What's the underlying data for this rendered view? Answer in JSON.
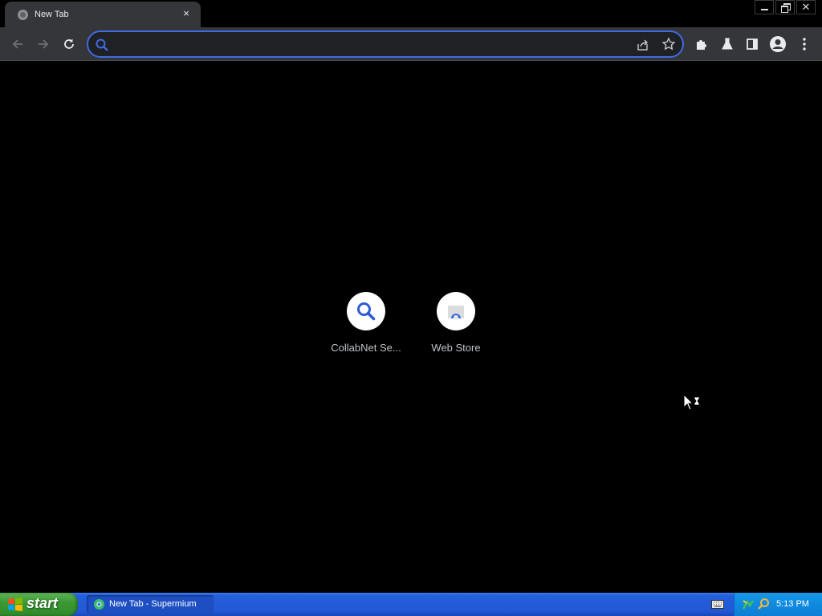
{
  "browser": {
    "tab": {
      "title": "New Tab",
      "favicon": "globe-icon",
      "close_label": "×"
    },
    "window_buttons": {
      "minimize": "minimize-icon",
      "restore": "restore-icon",
      "close_label": "✕"
    },
    "omnibox": {
      "value": "",
      "placeholder": ""
    },
    "accent_color": "#3f6ae3"
  },
  "shortcuts": [
    {
      "label": "CollabNet Se...",
      "icon": "search-icon"
    },
    {
      "label": "Web Store",
      "icon": "web-store-icon"
    }
  ],
  "taskbar": {
    "start_label": "start",
    "task": {
      "label": "New Tab - Supermium",
      "icon": "browser-icon"
    },
    "clock": "5:13 PM"
  }
}
